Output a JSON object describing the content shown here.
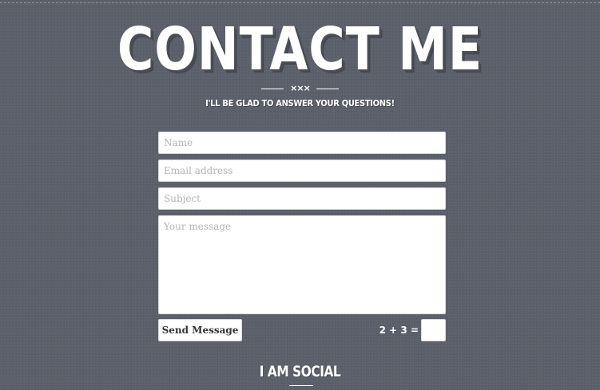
{
  "header": {
    "title": "CONTACT ME",
    "ornament": "×××",
    "subtitle": "I'LL BE GLAD TO ANSWER YOUR QUESTIONS!"
  },
  "form": {
    "name_placeholder": "Name",
    "email_placeholder": "Email address",
    "subject_placeholder": "Subject",
    "message_placeholder": "Your message",
    "send_label": "Send Message",
    "captcha_question": "2 + 3 =",
    "captcha_value": ""
  },
  "social": {
    "heading": "I AM SOCIAL"
  },
  "colors": {
    "background": "#5d616b",
    "text": "#ffffff",
    "field_background": "#ffffff"
  }
}
